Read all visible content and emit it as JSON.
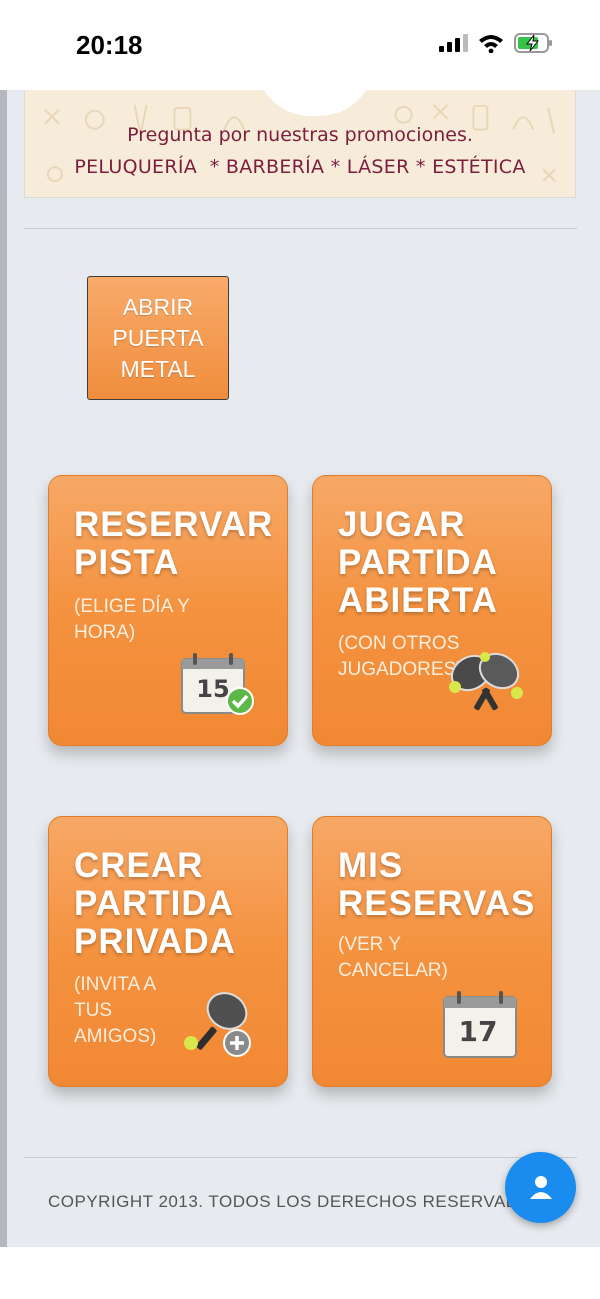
{
  "status_bar": {
    "time": "20:18",
    "icons": [
      "signal-icon",
      "wifi-icon",
      "battery-charging-icon"
    ]
  },
  "banner": {
    "promo_text": "Pregunta por nuestras promociones.",
    "services_text": "PELUQUERÍA  * BARBERÍA * LÁSER * ESTÉTICA"
  },
  "door_button": {
    "label": "ABRIR\nPUERTA\nMETAL"
  },
  "tiles": [
    {
      "title": "RESERVAR\nPISTA",
      "subtitle": "(ELIGE DÍA Y\nHORA)",
      "icon": "calendar-check-icon",
      "calendar_day": "15"
    },
    {
      "title": "JUGAR\nPARTIDA\nABIERTA",
      "subtitle": "(CON OTROS\nJUGADORES)",
      "icon": "padel-rackets-icon"
    },
    {
      "title": "CREAR\nPARTIDA\nPRIVADA",
      "subtitle": "(INVITA A\nTUS\nAMIGOS)",
      "icon": "padel-racket-add-icon"
    },
    {
      "title": "MIS\nRESERVAS",
      "subtitle": "(VER Y\nCANCELAR)",
      "icon": "calendar-icon",
      "calendar_day": "17"
    }
  ],
  "footer": {
    "copyright": "COPYRIGHT 2013. TODOS LOS DERECHOS RESERVADOS"
  },
  "fab": {
    "icon": "user-icon"
  },
  "colors": {
    "tile_orange": "#f4923f",
    "banner_text": "#7d1d3d",
    "fab_blue": "#1a8cf0",
    "page_bg": "#e7eaee"
  }
}
